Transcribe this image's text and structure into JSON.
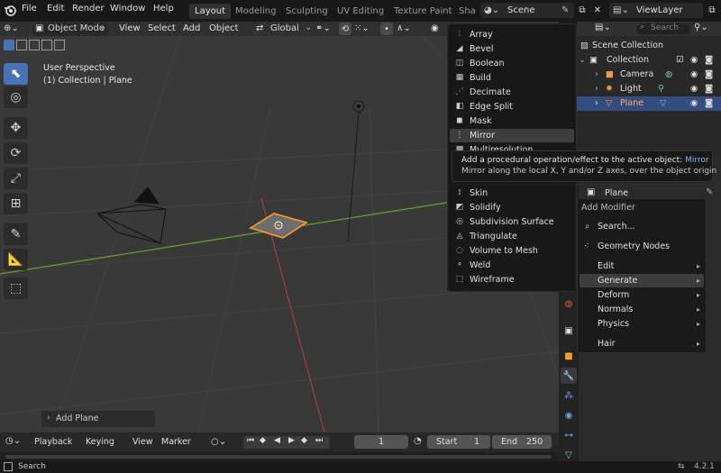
{
  "topbar": {
    "menus": [
      "File",
      "Edit",
      "Render",
      "Window",
      "Help"
    ],
    "tabs": [
      "Layout",
      "Modeling",
      "Sculpting",
      "UV Editing",
      "Texture Paint",
      "Sha"
    ],
    "active_tab": "Layout",
    "scene": "Scene",
    "view_layer": "ViewLayer"
  },
  "viewport_header": {
    "mode": "Object Mode",
    "menus": [
      "View",
      "Select",
      "Add",
      "Object"
    ],
    "orientation": "Global"
  },
  "viewport": {
    "perspective": "User Perspective",
    "collection": "(1) Collection | Plane",
    "last_op": "Add Plane"
  },
  "generate_menu": {
    "items": [
      {
        "label": "Array",
        "icon": "array-icon"
      },
      {
        "label": "Bevel",
        "icon": "bevel-icon"
      },
      {
        "label": "Boolean",
        "icon": "boolean-icon"
      },
      {
        "label": "Build",
        "icon": "build-icon"
      },
      {
        "label": "Decimate",
        "icon": "decimate-icon"
      },
      {
        "label": "Edge Split",
        "icon": "edge-split-icon"
      },
      {
        "label": "Mask",
        "icon": "mask-icon"
      },
      {
        "label": "Mirror",
        "icon": "mirror-icon"
      },
      {
        "label": "Multiresolution",
        "icon": "multires-icon"
      },
      {
        "label": "Skin",
        "icon": "skin-icon"
      },
      {
        "label": "Solidify",
        "icon": "solidify-icon"
      },
      {
        "label": "Subdivision Surface",
        "icon": "subsurf-icon"
      },
      {
        "label": "Triangulate",
        "icon": "triangulate-icon"
      },
      {
        "label": "Volume to Mesh",
        "icon": "volume-icon"
      },
      {
        "label": "Weld",
        "icon": "weld-icon"
      },
      {
        "label": "Wireframe",
        "icon": "wireframe-icon"
      }
    ],
    "highlighted": "Mirror"
  },
  "tooltip": {
    "line1": "Add a procedural operation/effect to the active object:",
    "line1_name": "Mirror",
    "line2": "Mirror along the local X, Y and/or Z axes, over the object origin"
  },
  "add_modifier": {
    "title": "Add Modifier",
    "search": "Search...",
    "geometry_nodes": "Geometry Nodes",
    "items": [
      "Edit",
      "Generate",
      "Deform",
      "Normals",
      "Physics"
    ],
    "hair": "Hair",
    "highlighted": "Generate"
  },
  "outliner": {
    "title": "Scene Collection",
    "collection": "Collection",
    "objects": [
      "Camera",
      "Light",
      "Plane"
    ],
    "selected": "Plane",
    "search_placeholder": "Search"
  },
  "properties": {
    "object_name": "Plane"
  },
  "timeline": {
    "menus": [
      "Playback",
      "Keying",
      "View",
      "Marker"
    ],
    "current_frame": "1",
    "start_label": "Start",
    "start": "1",
    "end_label": "End",
    "end": "250"
  },
  "statusbar": {
    "search": "Search",
    "version": "4.2.1"
  },
  "colors": {
    "accent": "#4772b3",
    "selection": "#ff9b29",
    "x_axis": "#9c3f3f",
    "y_axis": "#6c9a2d"
  }
}
